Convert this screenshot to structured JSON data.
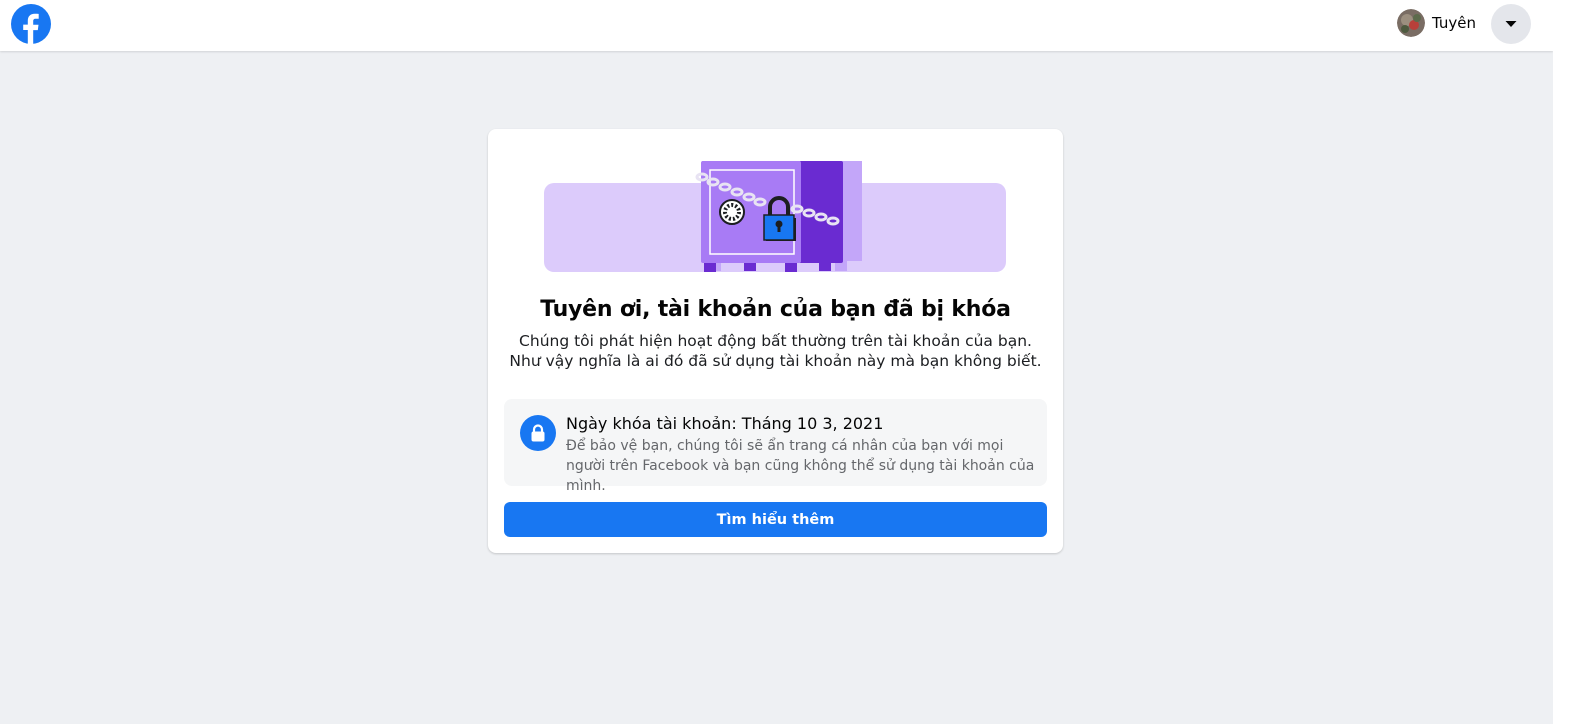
{
  "header": {
    "logo_icon": "facebook-logo-icon",
    "user_name": "Tuyên",
    "menu_icon": "caret-down-icon"
  },
  "checkpoint": {
    "illustration_icon": "locked-safe-illustration",
    "title": "Tuyên ơi, tài khoản của bạn đã bị khóa",
    "description": "Chúng tôi phát hiện hoạt động bất thường trên tài khoản của bạn. Như vậy nghĩa là ai đó đã sử dụng tài khoản này mà bạn không biết.",
    "info": {
      "icon": "lock-icon",
      "heading": "Ngày khóa tài khoản: Tháng 10 3, 2021",
      "text": "Để bảo vệ bạn, chúng tôi sẽ ẩn trang cá nhân của bạn với mọi người trên Facebook và bạn cũng không thể sử dụng tài khoản của mình."
    },
    "button_label": "Tìm hiểu thêm"
  },
  "colors": {
    "brand_blue": "#1877f2",
    "page_background": "#eef0f3",
    "illustration_lavender": "#dccbfb",
    "illustration_purple": "#a87bf5",
    "illustration_dark_purple": "#6a2bd1"
  }
}
